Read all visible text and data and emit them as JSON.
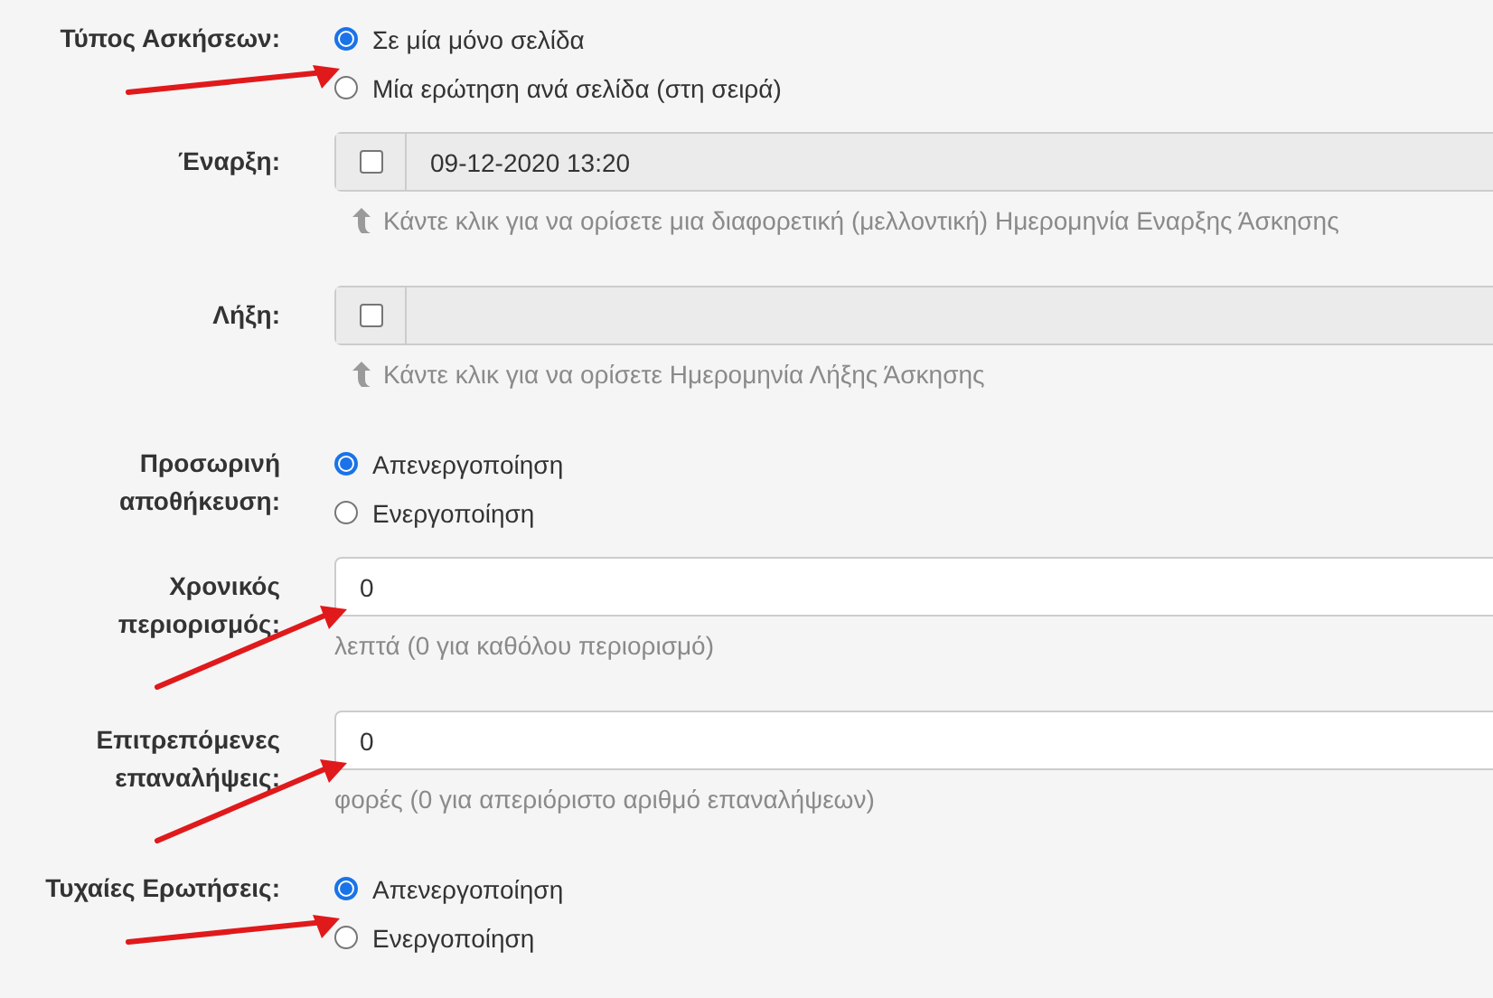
{
  "fields": [
    {
      "kind": "radio",
      "label": "Τύπος Ασκήσεων:",
      "options": [
        {
          "text": "Σε μία μόνο σελίδα",
          "selected": true,
          "arrow": false
        },
        {
          "text": "Μία ερώτηση ανά σελίδα (στη σειρά)",
          "selected": false,
          "arrow": true
        }
      ]
    },
    {
      "kind": "date",
      "label": "Έναρξη:",
      "checked": false,
      "value": "09-12-2020 13:20",
      "hint": "Κάντε κλικ για να ορίσετε μια διαφορετική (μελλοντική) Ημερομηνία Εναρξης Άσκησης",
      "arrow": false
    },
    {
      "kind": "date",
      "label": "Λήξη:",
      "checked": false,
      "hint": "Κάντε κλικ για να ορίσετε Ημερομηνία Λήξης Άσκησης",
      "arrow": false
    },
    {
      "kind": "radio",
      "label": "Προσωρινή αποθήκευση:",
      "options": [
        {
          "text": "Απενεργοποίηση",
          "selected": true,
          "arrow": false
        },
        {
          "text": "Ενεργοποίηση",
          "selected": false,
          "arrow": false
        }
      ]
    },
    {
      "kind": "number",
      "label": "Χρονικός περιορισμός:",
      "value": "0",
      "hint": "λεπτά (0 για καθόλου περιορισμό)",
      "arrow": true
    },
    {
      "kind": "number",
      "label": "Επιτρεπόμενες επαναλήψεις:",
      "value": "0",
      "hint": "φορές (0 για απεριόριστο αριθμό επαναλήψεων)",
      "arrow": true
    },
    {
      "kind": "radio",
      "label": "Τυχαίες Ερωτήσεις:",
      "options": [
        {
          "text": "Απενεργοποίηση",
          "selected": true,
          "arrow": false
        },
        {
          "text": "Ενεργοποίηση",
          "selected": false,
          "arrow": true
        }
      ]
    }
  ]
}
